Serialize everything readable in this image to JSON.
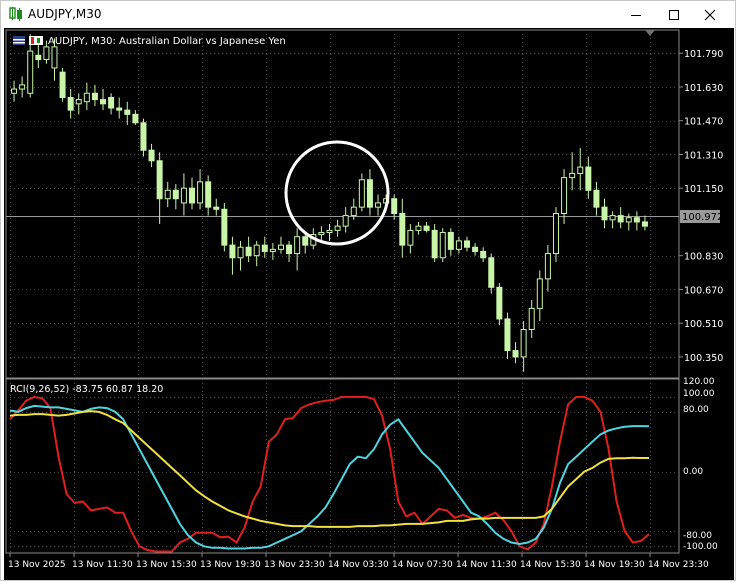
{
  "window": {
    "title": "AUDJPY,M30"
  },
  "chart_header": {
    "symbol_line": "AUDJPY, M30:  Australian Dollar vs Japanese Yen"
  },
  "indicator": {
    "label": "RCI(9,26,52) -83.75 60.87 18.20"
  },
  "price_axis": {
    "labels": [
      "101.790",
      "101.630",
      "101.470",
      "101.310",
      "101.150",
      "100.830",
      "100.670",
      "100.510",
      "100.350"
    ],
    "current": "100.972"
  },
  "indicator_axis": {
    "labels": [
      "120.00",
      "100.00",
      "80.00",
      "0.00",
      "-80.00",
      "-100.00"
    ]
  },
  "time_axis": {
    "labels": [
      "13 Nov 2025",
      "13 Nov 11:30",
      "13 Nov 15:30",
      "13 Nov 19:30",
      "13 Nov 23:30",
      "14 Nov 03:30",
      "14 Nov 07:30",
      "14 Nov 11:30",
      "14 Nov 15:30",
      "14 Nov 19:30",
      "14 Nov 23:30"
    ]
  },
  "colors": {
    "bg": "#000000",
    "candle": "#c8f5a8",
    "grid": "#4a4a4a",
    "red": "#e0201e",
    "cyan": "#4fd5e0",
    "yellow": "#f0e040",
    "axis_text": "#ffffff"
  },
  "chart_data": [
    {
      "type": "candlestick",
      "title": "AUDJPY, M30:  Australian Dollar vs Japanese Yen",
      "ylim": [
        100.25,
        101.9
      ],
      "candles": [
        {
          "o": 101.6,
          "h": 101.66,
          "l": 101.56,
          "c": 101.62
        },
        {
          "o": 101.62,
          "h": 101.68,
          "l": 101.58,
          "c": 101.64
        },
        {
          "o": 101.6,
          "h": 101.88,
          "l": 101.58,
          "c": 101.8
        },
        {
          "o": 101.78,
          "h": 101.84,
          "l": 101.72,
          "c": 101.76
        },
        {
          "o": 101.76,
          "h": 101.85,
          "l": 101.74,
          "c": 101.82
        },
        {
          "o": 101.72,
          "h": 101.86,
          "l": 101.66,
          "c": 101.82
        },
        {
          "o": 101.7,
          "h": 101.72,
          "l": 101.56,
          "c": 101.58
        },
        {
          "o": 101.58,
          "h": 101.62,
          "l": 101.48,
          "c": 101.52
        },
        {
          "o": 101.55,
          "h": 101.6,
          "l": 101.5,
          "c": 101.57
        },
        {
          "o": 101.56,
          "h": 101.65,
          "l": 101.52,
          "c": 101.6
        },
        {
          "o": 101.6,
          "h": 101.64,
          "l": 101.54,
          "c": 101.57
        },
        {
          "o": 101.57,
          "h": 101.62,
          "l": 101.52,
          "c": 101.55
        },
        {
          "o": 101.58,
          "h": 101.6,
          "l": 101.5,
          "c": 101.53
        },
        {
          "o": 101.53,
          "h": 101.58,
          "l": 101.48,
          "c": 101.52
        },
        {
          "o": 101.52,
          "h": 101.56,
          "l": 101.45,
          "c": 101.5
        },
        {
          "o": 101.5,
          "h": 101.52,
          "l": 101.45,
          "c": 101.46
        },
        {
          "o": 101.46,
          "h": 101.48,
          "l": 101.3,
          "c": 101.33
        },
        {
          "o": 101.33,
          "h": 101.36,
          "l": 101.25,
          "c": 101.28
        },
        {
          "o": 101.28,
          "h": 101.32,
          "l": 100.98,
          "c": 101.1
        },
        {
          "o": 101.1,
          "h": 101.18,
          "l": 101.06,
          "c": 101.14
        },
        {
          "o": 101.14,
          "h": 101.17,
          "l": 101.05,
          "c": 101.1
        },
        {
          "o": 101.08,
          "h": 101.22,
          "l": 101.02,
          "c": 101.15
        },
        {
          "o": 101.15,
          "h": 101.2,
          "l": 101.05,
          "c": 101.08
        },
        {
          "o": 101.08,
          "h": 101.24,
          "l": 101.05,
          "c": 101.18
        },
        {
          "o": 101.18,
          "h": 101.21,
          "l": 101.02,
          "c": 101.06
        },
        {
          "o": 101.06,
          "h": 101.1,
          "l": 101.02,
          "c": 101.05
        },
        {
          "o": 101.05,
          "h": 101.08,
          "l": 100.85,
          "c": 100.88
        },
        {
          "o": 100.88,
          "h": 100.92,
          "l": 100.74,
          "c": 100.82
        },
        {
          "o": 100.82,
          "h": 100.9,
          "l": 100.76,
          "c": 100.87
        },
        {
          "o": 100.87,
          "h": 100.92,
          "l": 100.8,
          "c": 100.83
        },
        {
          "o": 100.83,
          "h": 100.9,
          "l": 100.78,
          "c": 100.88
        },
        {
          "o": 100.88,
          "h": 100.92,
          "l": 100.82,
          "c": 100.85
        },
        {
          "o": 100.85,
          "h": 100.89,
          "l": 100.81,
          "c": 100.86
        },
        {
          "o": 100.86,
          "h": 100.92,
          "l": 100.84,
          "c": 100.88
        },
        {
          "o": 100.88,
          "h": 100.9,
          "l": 100.8,
          "c": 100.84
        },
        {
          "o": 100.84,
          "h": 100.96,
          "l": 100.76,
          "c": 100.92
        },
        {
          "o": 100.92,
          "h": 100.94,
          "l": 100.84,
          "c": 100.88
        },
        {
          "o": 100.88,
          "h": 100.96,
          "l": 100.86,
          "c": 100.93
        },
        {
          "o": 100.93,
          "h": 100.97,
          "l": 100.89,
          "c": 100.94
        },
        {
          "o": 100.94,
          "h": 100.98,
          "l": 100.9,
          "c": 100.95
        },
        {
          "o": 100.95,
          "h": 101.0,
          "l": 100.92,
          "c": 100.97
        },
        {
          "o": 100.97,
          "h": 101.06,
          "l": 100.94,
          "c": 101.02
        },
        {
          "o": 101.02,
          "h": 101.1,
          "l": 101.0,
          "c": 101.06
        },
        {
          "o": 101.06,
          "h": 101.22,
          "l": 101.04,
          "c": 101.19
        },
        {
          "o": 101.19,
          "h": 101.24,
          "l": 101.02,
          "c": 101.06
        },
        {
          "o": 101.06,
          "h": 101.12,
          "l": 101.02,
          "c": 101.08
        },
        {
          "o": 101.08,
          "h": 101.12,
          "l": 101.04,
          "c": 101.1
        },
        {
          "o": 101.1,
          "h": 101.12,
          "l": 101.0,
          "c": 101.03
        },
        {
          "o": 101.03,
          "h": 101.1,
          "l": 100.82,
          "c": 100.88
        },
        {
          "o": 100.88,
          "h": 100.98,
          "l": 100.84,
          "c": 100.95
        },
        {
          "o": 100.95,
          "h": 100.99,
          "l": 100.93,
          "c": 100.97
        },
        {
          "o": 100.97,
          "h": 100.99,
          "l": 100.94,
          "c": 100.95
        },
        {
          "o": 100.95,
          "h": 100.98,
          "l": 100.8,
          "c": 100.82
        },
        {
          "o": 100.82,
          "h": 100.96,
          "l": 100.8,
          "c": 100.94
        },
        {
          "o": 100.94,
          "h": 100.96,
          "l": 100.83,
          "c": 100.86
        },
        {
          "o": 100.86,
          "h": 100.92,
          "l": 100.84,
          "c": 100.9
        },
        {
          "o": 100.9,
          "h": 100.92,
          "l": 100.85,
          "c": 100.87
        },
        {
          "o": 100.87,
          "h": 100.89,
          "l": 100.83,
          "c": 100.85
        },
        {
          "o": 100.85,
          "h": 100.87,
          "l": 100.8,
          "c": 100.82
        },
        {
          "o": 100.82,
          "h": 100.84,
          "l": 100.65,
          "c": 100.68
        },
        {
          "o": 100.68,
          "h": 100.7,
          "l": 100.5,
          "c": 100.53
        },
        {
          "o": 100.53,
          "h": 100.56,
          "l": 100.34,
          "c": 100.38
        },
        {
          "o": 100.38,
          "h": 100.42,
          "l": 100.32,
          "c": 100.35
        },
        {
          "o": 100.35,
          "h": 100.52,
          "l": 100.28,
          "c": 100.48
        },
        {
          "o": 100.48,
          "h": 100.62,
          "l": 100.44,
          "c": 100.58
        },
        {
          "o": 100.58,
          "h": 100.76,
          "l": 100.52,
          "c": 100.72
        },
        {
          "o": 100.72,
          "h": 100.88,
          "l": 100.66,
          "c": 100.84
        },
        {
          "o": 100.84,
          "h": 101.06,
          "l": 100.8,
          "c": 101.03
        },
        {
          "o": 101.03,
          "h": 101.24,
          "l": 100.98,
          "c": 101.2
        },
        {
          "o": 101.2,
          "h": 101.32,
          "l": 101.14,
          "c": 101.22
        },
        {
          "o": 101.22,
          "h": 101.34,
          "l": 101.14,
          "c": 101.25
        },
        {
          "o": 101.25,
          "h": 101.3,
          "l": 101.1,
          "c": 101.14
        },
        {
          "o": 101.14,
          "h": 101.18,
          "l": 101.02,
          "c": 101.06
        },
        {
          "o": 101.06,
          "h": 101.1,
          "l": 100.96,
          "c": 101.0
        },
        {
          "o": 101.0,
          "h": 101.04,
          "l": 100.96,
          "c": 101.02
        },
        {
          "o": 101.02,
          "h": 101.06,
          "l": 100.96,
          "c": 100.99
        },
        {
          "o": 100.99,
          "h": 101.03,
          "l": 100.95,
          "c": 101.01
        },
        {
          "o": 101.01,
          "h": 101.04,
          "l": 100.95,
          "c": 100.99
        },
        {
          "o": 100.99,
          "h": 101.02,
          "l": 100.95,
          "c": 100.97
        }
      ]
    },
    {
      "type": "line",
      "title": "RCI(9,26,52) -83.75 60.87 18.20",
      "ylim": [
        -105,
        120
      ],
      "series": [
        {
          "name": "RCI 9",
          "color": "#e0201e",
          "values": [
            70,
            82,
            95,
            100,
            98,
            85,
            20,
            -30,
            -42,
            -40,
            -52,
            -50,
            -48,
            -55,
            -55,
            -80,
            -100,
            -105,
            -107,
            -107,
            -107,
            -95,
            -90,
            -82,
            -82,
            -82,
            -88,
            -87,
            -95,
            -75,
            -40,
            -20,
            40,
            50,
            70,
            72,
            85,
            90,
            93,
            95,
            96,
            100,
            100,
            100,
            100,
            97,
            75,
            30,
            -40,
            -60,
            -55,
            -70,
            -60,
            -50,
            -52,
            -62,
            -58,
            -62,
            -63,
            -60,
            -55,
            -65,
            -80,
            -100,
            -104,
            -95,
            -70,
            -20,
            40,
            90,
            100,
            100,
            95,
            80,
            30,
            -40,
            -80,
            -95,
            -93,
            -83.75
          ]
        },
        {
          "name": "RCI 26",
          "color": "#4fd5e0",
          "values": [
            82,
            80,
            85,
            88,
            87,
            86,
            86,
            84,
            82,
            80,
            84,
            86,
            85,
            80,
            70,
            50,
            30,
            10,
            -10,
            -30,
            -50,
            -70,
            -85,
            -95,
            -100,
            -102,
            -102,
            -103,
            -103,
            -103,
            -102,
            -102,
            -100,
            -95,
            -90,
            -85,
            -80,
            -70,
            -60,
            -48,
            -30,
            -10,
            10,
            20,
            18,
            30,
            50,
            63,
            70,
            55,
            40,
            25,
            15,
            5,
            -10,
            -25,
            -40,
            -55,
            -60,
            -70,
            -82,
            -90,
            -95,
            -97,
            -95,
            -90,
            -75,
            -50,
            -15,
            10,
            20,
            30,
            40,
            50,
            55,
            58,
            60,
            61,
            61,
            60.87
          ]
        },
        {
          "name": "RCI 52",
          "color": "#f0e040",
          "values": [
            75,
            76,
            76,
            77,
            77,
            76,
            75,
            76,
            78,
            80,
            81,
            80,
            76,
            70,
            65,
            55,
            45,
            35,
            25,
            15,
            5,
            -5,
            -15,
            -25,
            -33,
            -40,
            -46,
            -52,
            -56,
            -60,
            -63,
            -66,
            -68,
            -70,
            -72,
            -73,
            -73,
            -73,
            -74,
            -74,
            -74,
            -74,
            -74,
            -73,
            -73,
            -73,
            -72,
            -72,
            -71,
            -70,
            -70,
            -70,
            -69,
            -68,
            -66,
            -66,
            -66,
            -64,
            -63,
            -63,
            -62,
            -62,
            -62,
            -62,
            -62,
            -62,
            -60,
            -50,
            -35,
            -20,
            -10,
            0,
            5,
            12,
            17,
            18,
            18,
            18.5,
            18.2,
            18.2
          ]
        }
      ]
    }
  ]
}
